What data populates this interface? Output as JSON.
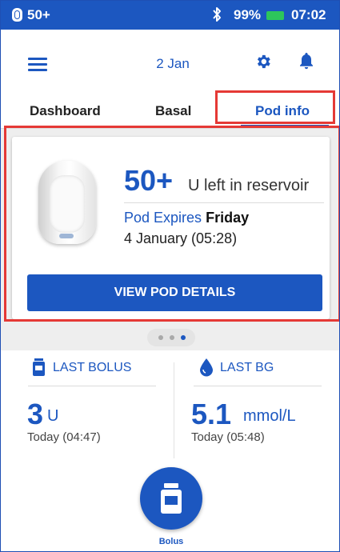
{
  "status_bar": {
    "pod_level": "50+",
    "bluetooth_icon": "bluetooth-icon",
    "battery_percent": "99%",
    "battery_level": 0.99,
    "battery_color": "#2dc65b",
    "time": "07:02"
  },
  "header": {
    "menu_icon": "hamburger-menu-icon",
    "date": "2 Jan",
    "settings_icon": "gear-icon",
    "notifications_icon": "bell-icon"
  },
  "tabs": [
    {
      "label": "Dashboard",
      "active": false
    },
    {
      "label": "Basal",
      "active": false
    },
    {
      "label": "Pod info",
      "active": true
    }
  ],
  "pod_card": {
    "reservoir_value": "50+",
    "reservoir_text": "U left in reservoir",
    "expires_label": "Pod Expires",
    "expires_day": "Friday",
    "expires_date": "4 January (05:28)",
    "button_label": "VIEW POD DETAILS"
  },
  "carousel": {
    "page_count": 3,
    "active_page": 3
  },
  "last_bolus": {
    "label": "LAST BOLUS",
    "value": "3",
    "unit": "U",
    "time": "Today (04:47)"
  },
  "last_bg": {
    "label": "LAST BG",
    "value": "5.1",
    "unit": "mmol/L",
    "time": "Today (05:48)"
  },
  "bolus_button": {
    "label": "Bolus",
    "icon": "vial-icon"
  },
  "colors": {
    "primary": "#1c57c0",
    "highlight": "#e53935"
  }
}
